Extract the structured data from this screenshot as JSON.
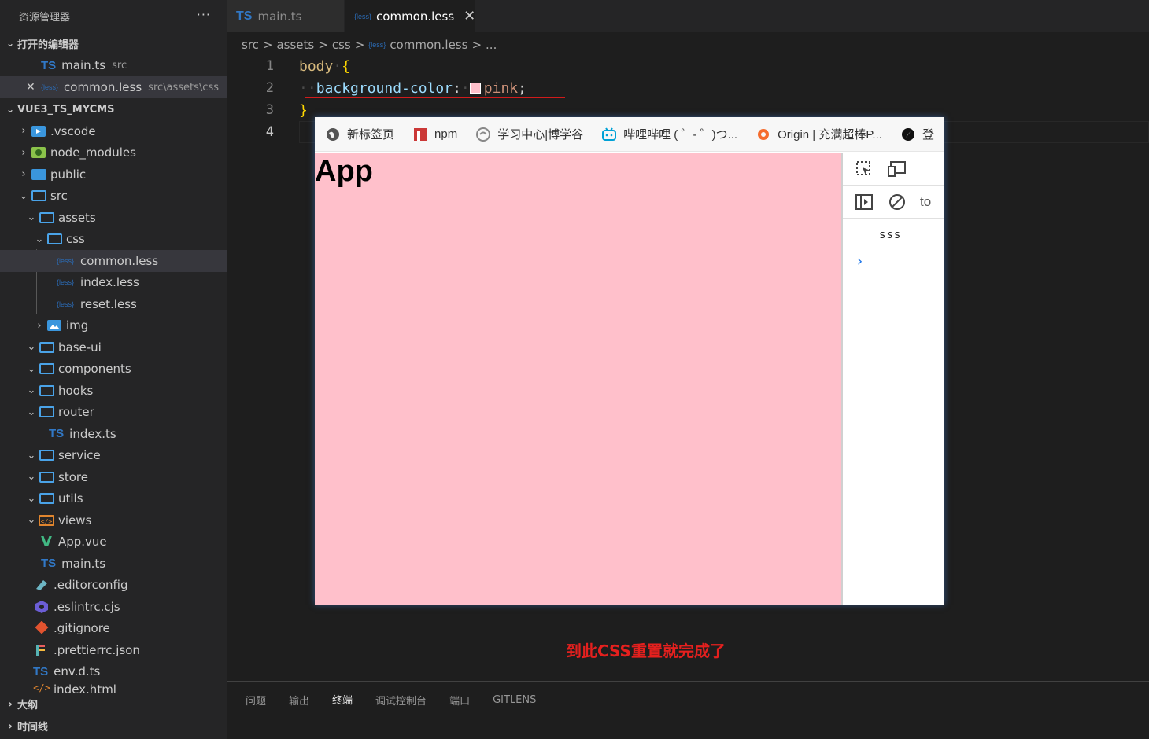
{
  "sidebar": {
    "title": "资源管理器",
    "more": "···",
    "open_editors": {
      "label": "打开的编辑器",
      "items": [
        {
          "name": "main.ts",
          "desc": "src",
          "icon": "TS"
        },
        {
          "name": "common.less",
          "desc": "src\\assets\\css",
          "icon": "{less}"
        }
      ]
    },
    "project": {
      "label": "VUE3_TS_MYCMS",
      "items": [
        {
          "name": ".vscode",
          "chev": "›"
        },
        {
          "name": "node_modules",
          "chev": "›"
        },
        {
          "name": "public",
          "chev": "›"
        },
        {
          "name": "src",
          "chev": "⌄"
        },
        {
          "name": "assets",
          "chev": "⌄"
        },
        {
          "name": "css",
          "chev": "⌄"
        },
        {
          "name": "common.less",
          "icon": "{less}"
        },
        {
          "name": "index.less",
          "icon": "{less}"
        },
        {
          "name": "reset.less",
          "icon": "{less}"
        },
        {
          "name": "img",
          "chev": "›"
        },
        {
          "name": "base-ui",
          "chev": "⌄"
        },
        {
          "name": "components",
          "chev": "⌄"
        },
        {
          "name": "hooks",
          "chev": "⌄"
        },
        {
          "name": "router",
          "chev": "⌄"
        },
        {
          "name": "index.ts",
          "icon": "TS"
        },
        {
          "name": "service",
          "chev": "⌄"
        },
        {
          "name": "store",
          "chev": "⌄"
        },
        {
          "name": "utils",
          "chev": "⌄"
        },
        {
          "name": "views",
          "chev": "⌄"
        },
        {
          "name": "App.vue",
          "icon": "V"
        },
        {
          "name": "main.ts",
          "icon": "TS"
        },
        {
          "name": ".editorconfig"
        },
        {
          "name": ".eslintrc.cjs"
        },
        {
          "name": ".gitignore"
        },
        {
          "name": ".prettierrc.json"
        },
        {
          "name": "env.d.ts",
          "icon": "TS"
        },
        {
          "name": "index.html"
        }
      ]
    },
    "outline": "大纲",
    "timeline": "时间线"
  },
  "tabs": [
    {
      "label": "main.ts",
      "icon": "TS"
    },
    {
      "label": "common.less",
      "icon": "{less}",
      "close": "✕"
    }
  ],
  "breadcrumb": {
    "parts": [
      "src",
      "assets",
      "css",
      "common.less",
      "..."
    ],
    "sep": ">"
  },
  "editor": {
    "line_numbers": [
      "1",
      "2",
      "3",
      "4"
    ],
    "line1": {
      "selector": "body",
      "brace": "{"
    },
    "line2": {
      "property": "background-color",
      "colon": ":",
      "value": "pink",
      "semi": ";"
    },
    "line3": {
      "brace": "}"
    }
  },
  "browser": {
    "bookmarks": [
      "新标签页",
      "npm",
      "学习中心|博学谷",
      "哔哩哔哩 ( ゜- ゜)つ...",
      "Origin | 充满超棒P...",
      "登"
    ],
    "page_heading": "App",
    "devtools_text": "to",
    "console_output": "sss",
    "console_prompt": "›"
  },
  "caption": "到此CSS重置就完成了",
  "panel": {
    "tabs": [
      "问题",
      "输出",
      "终端",
      "调试控制台",
      "端口",
      "GITLENS"
    ],
    "active": "终端"
  },
  "colors": {
    "pink_page": "#ffc0cb",
    "caption_red": "#e5201e",
    "ts_blue": "#3178c6",
    "less_blue": "#2b6bb5"
  }
}
